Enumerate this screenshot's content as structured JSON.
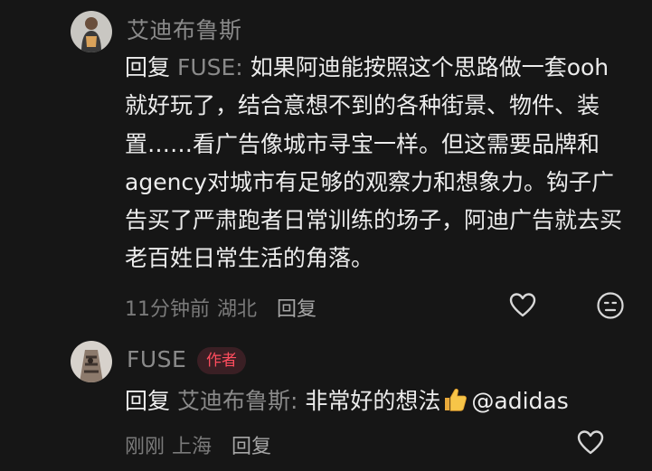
{
  "comments": [
    {
      "username": "艾迪布鲁斯",
      "reply_prefix": "回复",
      "reply_to": "FUSE:",
      "text": "如果阿迪能按照这个思路做一套ooh就好玩了，结合意想不到的各种街景、物件、装置……看广告像城市寻宝一样。但这需要品牌和agency对城市有足够的观察力和想象力。钩子广告买了严肃跑者日常训练的场子，阿迪广告就去买老百姓日常生活的角落。",
      "time": "11分钟前",
      "location": "湖北",
      "reply_label": "回复",
      "like_icon": "heart-outline-icon",
      "extra_icon": "emoji-face-icon"
    },
    {
      "username": "FUSE",
      "badge": "作者",
      "reply_prefix": "回复",
      "reply_to": "艾迪布鲁斯:",
      "text_before_emoji": "非常好的想法",
      "emoji": "thumbs-up-icon",
      "text_after_emoji": "@adidas",
      "time": "刚刚",
      "location": "上海",
      "reply_label": "回复",
      "like_icon": "heart-outline-icon"
    }
  ],
  "colors": {
    "background": "#161616",
    "text": "#ececec",
    "muted": "#8a8a8a",
    "badge_text": "#ff4d5e",
    "badge_bg": "#3a1f24"
  }
}
